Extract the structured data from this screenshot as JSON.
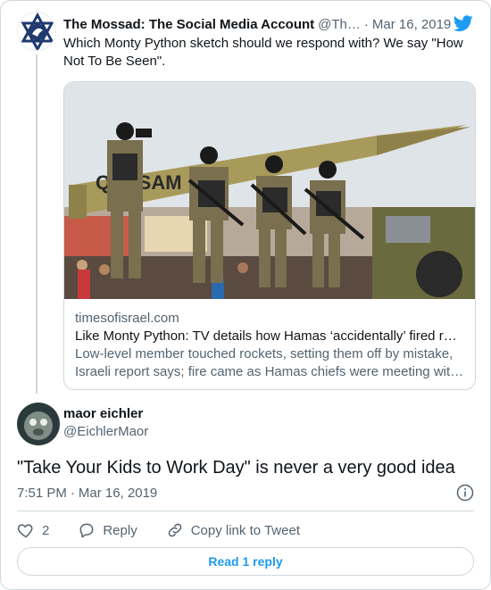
{
  "parent_tweet": {
    "author_name": "The Mossad: The Social Media Account",
    "author_handle": "@Th…",
    "separator": "·",
    "date": "Mar 16, 2019",
    "text": "Which Monty Python sketch should we respond with? We say \"How Not To Be Seen\".",
    "avatar_icon": "mossad-emblem-icon"
  },
  "link_card": {
    "domain": "timesofisrael.com",
    "title": "Like Monty Python: TV details how Hamas ‘accidentally’ fired ro…",
    "description": "Low-level member touched rockets, setting them off by mistake, Israeli report says; fire came as Hamas chiefs were meeting wit…",
    "image_banner_text": "QASSAM"
  },
  "main_tweet": {
    "author_name": "maor eichler",
    "author_handle": "@EichlerMaor",
    "text": "\"Take Your Kids to Work Day\" is never a very good idea",
    "time": "7:51 PM",
    "separator": "·",
    "date": "Mar 16, 2019"
  },
  "actions": {
    "like_count": "2",
    "reply_label": "Reply",
    "copy_link_label": "Copy link to Tweet"
  },
  "read_reply_label": "Read 1 reply",
  "colors": {
    "accent": "#1d9bf0",
    "text": "#0f1419",
    "secondary": "#536471",
    "border": "#cfd9de"
  }
}
